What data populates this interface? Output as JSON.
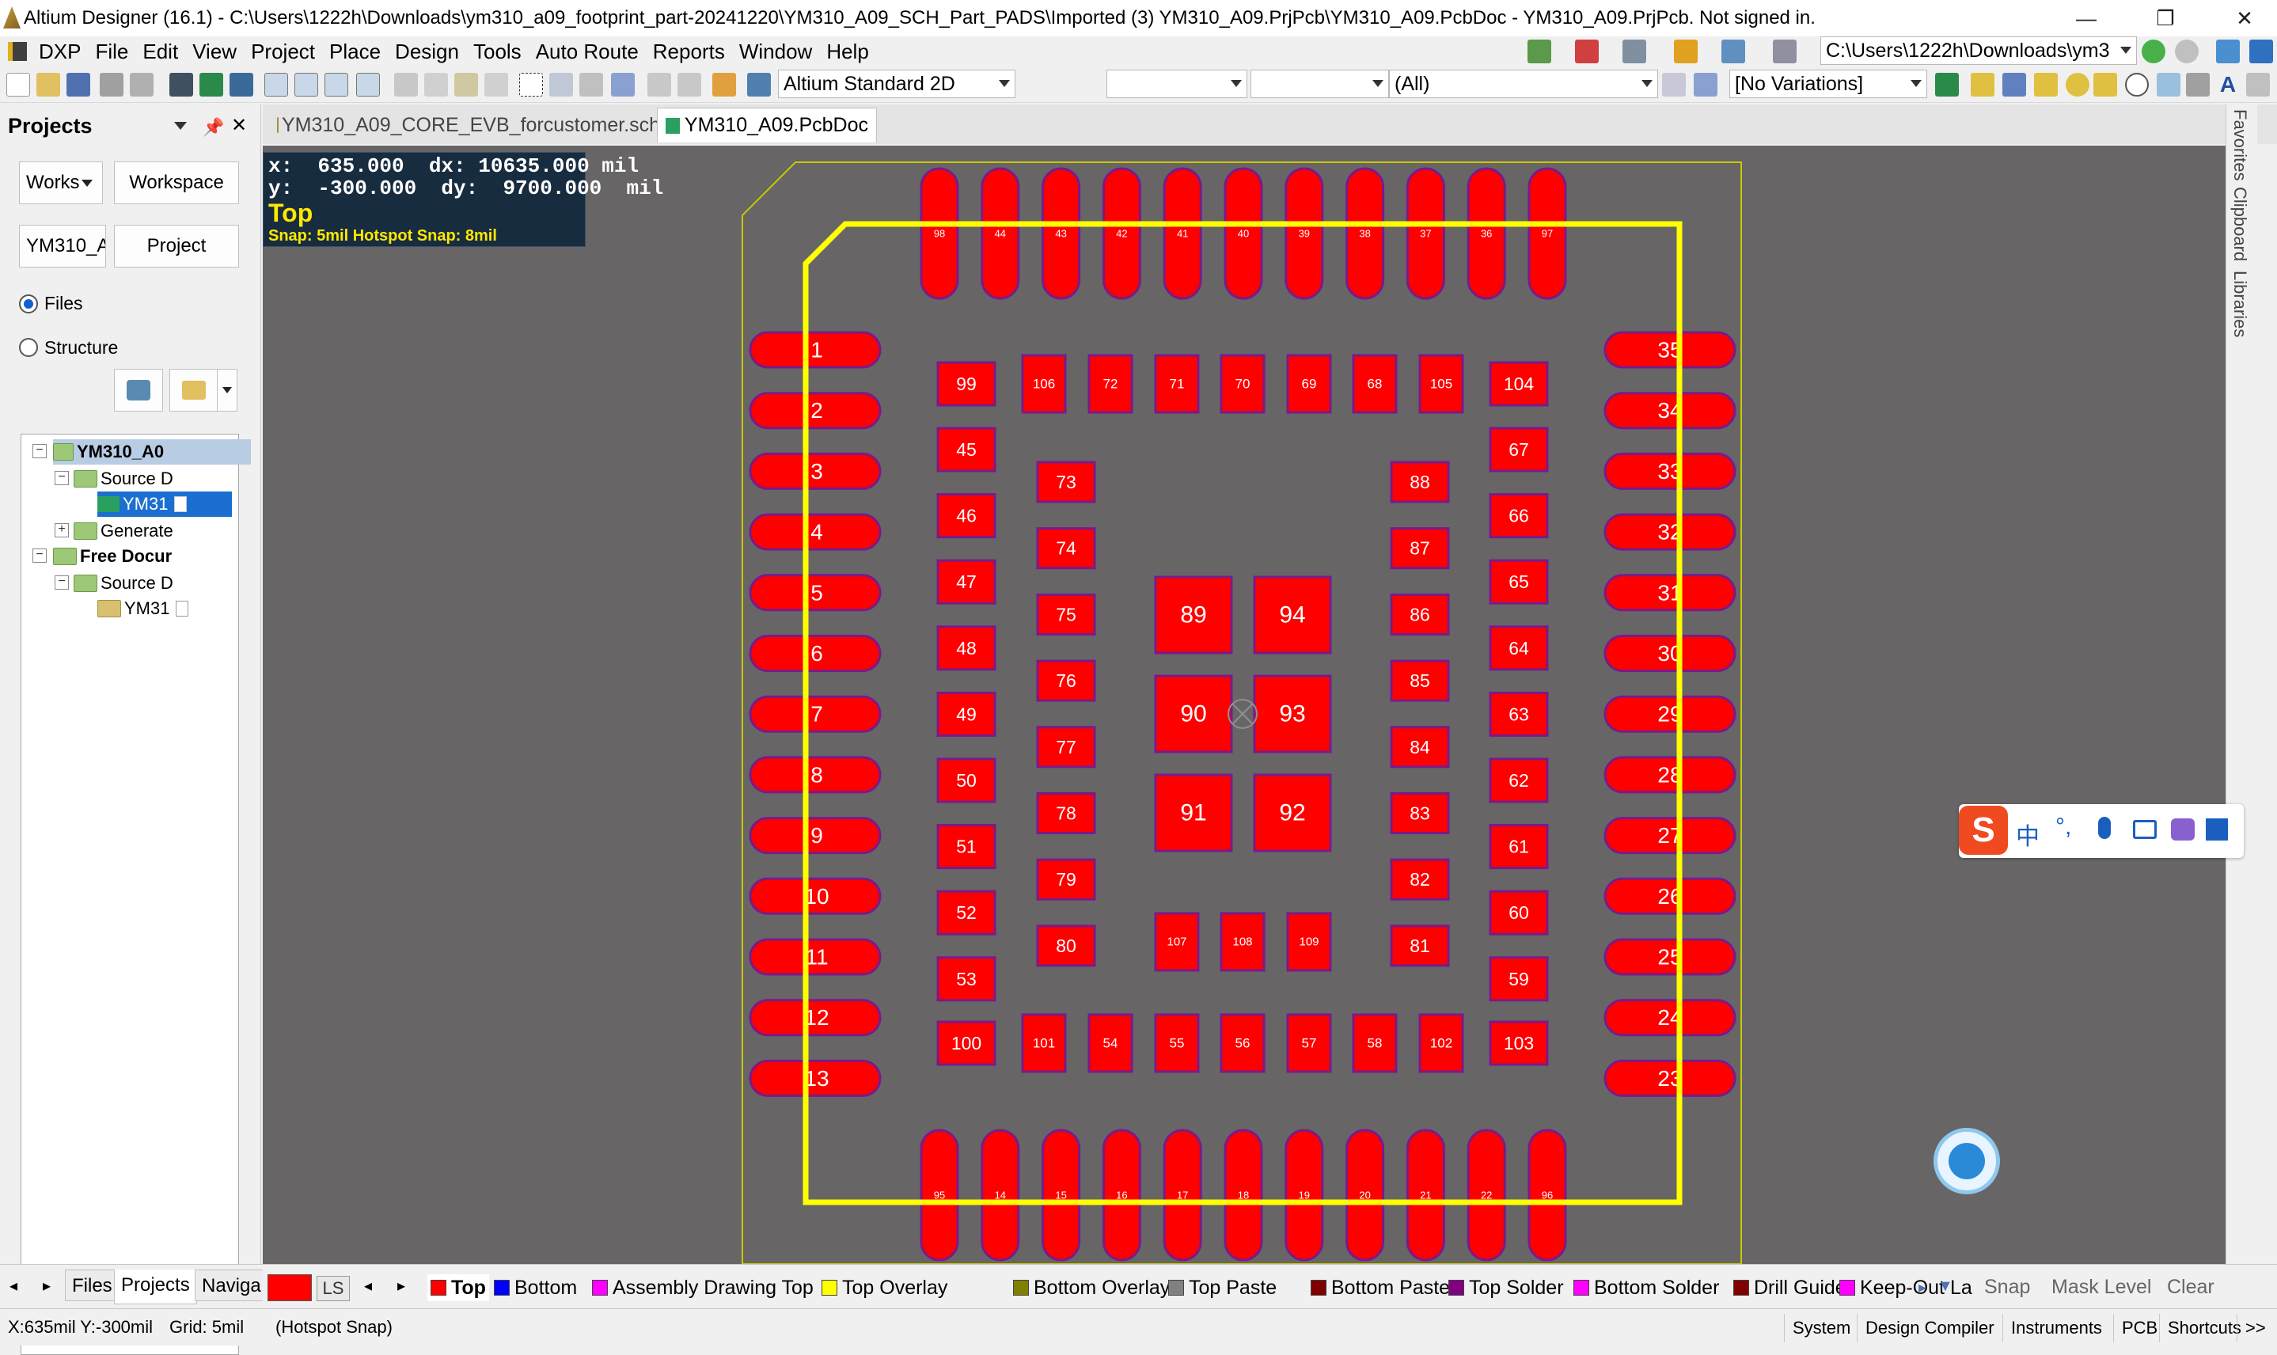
{
  "titlebar": {
    "title": "Altium Designer (16.1) - C:\\Users\\1222h\\Downloads\\ym310_a09_footprint_part-20241220\\YM310_A09_SCH_Part_PADS\\Imported (3) YM310_A09.PrjPcb\\YM310_A09.PcbDoc - YM310_A09.PrjPcb. Not signed in."
  },
  "menu": [
    "DXP",
    "File",
    "Edit",
    "View",
    "Project",
    "Place",
    "Design",
    "Tools",
    "Auto Route",
    "Reports",
    "Window",
    "Help"
  ],
  "path_combo": "C:\\Users\\1222h\\Downloads\\ym3",
  "toolbar": {
    "view_combo": "Altium Standard 2D",
    "filter_combo": "(All)",
    "variations_combo": "[No Variations]"
  },
  "panel": {
    "title": "Projects",
    "workspace_combo": "Works",
    "workspace_button": "Workspace",
    "project_field": "YM310_A(",
    "project_button": "Project",
    "radio_files": "Files",
    "radio_structure": "Structure",
    "tree": [
      {
        "label": "YM310_A0",
        "bold": true,
        "expander": "−"
      },
      {
        "label": "Source D",
        "bold": false,
        "expander": "−"
      },
      {
        "label": "YM31",
        "bold": false,
        "expander": ""
      },
      {
        "label": "Generate",
        "bold": false,
        "expander": "+"
      },
      {
        "label": "Free Docur",
        "bold": true,
        "expander": "−"
      },
      {
        "label": "Source D",
        "bold": false,
        "expander": "−"
      },
      {
        "label": "YM31",
        "bold": false,
        "expander": ""
      }
    ],
    "tabs": [
      "Files",
      "Projects",
      "Naviga"
    ]
  },
  "doc_tabs": [
    "YM310_A09_CORE_EVB_forcustomer.sch",
    "YM310_A09.PcbDoc"
  ],
  "right_strip": [
    "Favorites",
    "Clipboard",
    "Libraries"
  ],
  "coords": {
    "x_line": "x:  635.000  dx: 10635.000 mil",
    "y_line": "y:  -300.000  dy:  9700.000  mil",
    "layer": "Top",
    "snap": "Snap: 5mil Hotspot Snap: 8mil"
  },
  "pads": {
    "left": [
      "1",
      "2",
      "3",
      "4",
      "5",
      "6",
      "7",
      "8",
      "9",
      "10",
      "11",
      "12",
      "13"
    ],
    "right": [
      "35",
      "34",
      "33",
      "32",
      "31",
      "30",
      "29",
      "28",
      "27",
      "26",
      "25",
      "24",
      "23"
    ],
    "top": [
      "98",
      "44",
      "43",
      "42",
      "41",
      "40",
      "39",
      "38",
      "37",
      "36",
      "97"
    ],
    "bottom": [
      "95",
      "14",
      "15",
      "16",
      "17",
      "18",
      "19",
      "20",
      "21",
      "22",
      "96"
    ],
    "inner_top": [
      "99",
      "106",
      "72",
      "71",
      "70",
      "69",
      "68",
      "105",
      "104"
    ],
    "inner_left": [
      "45",
      "46",
      "47",
      "48",
      "49",
      "50",
      "51",
      "52",
      "53"
    ],
    "inner_right": [
      "67",
      "66",
      "65",
      "64",
      "63",
      "62",
      "61",
      "60",
      "59"
    ],
    "inner_bottom": [
      "100",
      "101",
      "54",
      "55",
      "56",
      "57",
      "58",
      "102",
      "103"
    ],
    "ring_left": [
      "73",
      "74",
      "75",
      "76",
      "77",
      "78",
      "79",
      "80"
    ],
    "ring_right": [
      "88",
      "87",
      "86",
      "85",
      "84",
      "83",
      "82",
      "81"
    ],
    "center": [
      "89",
      "94",
      "90",
      "93",
      "91",
      "92"
    ],
    "center_small": [
      "107",
      "108",
      "109"
    ]
  },
  "colors": {
    "board_bg": "#676566",
    "pad_fill": "#ff0000",
    "pad_outline": "#7a1a8a",
    "overlay": "#ffff00",
    "board_outline": "#c8c800"
  },
  "layer_bar": {
    "current_swatch_label": "LS",
    "layers": [
      {
        "name": "Top",
        "color": "#ff0000",
        "bold": true
      },
      {
        "name": "Bottom",
        "color": "#0000ff",
        "bold": false
      },
      {
        "name": "Assembly Drawing Top",
        "color": "#ff00ff",
        "bold": false
      },
      {
        "name": "Top Overlay",
        "color": "#ffff00",
        "bold": false
      },
      {
        "name": "Bottom Overlay",
        "color": "#808000",
        "bold": false
      },
      {
        "name": "Top Paste",
        "color": "#808080",
        "bold": false
      },
      {
        "name": "Bottom Paste",
        "color": "#800000",
        "bold": false
      },
      {
        "name": "Top Solder",
        "color": "#800080",
        "bold": false
      },
      {
        "name": "Bottom Solder",
        "color": "#ff00ff",
        "bold": false
      },
      {
        "name": "Drill Guide",
        "color": "#800000",
        "bold": false
      },
      {
        "name": "Keep-Out La",
        "color": "#ff00ff",
        "bold": false
      }
    ],
    "buttons": [
      "Snap",
      "Mask Level",
      "Clear"
    ]
  },
  "status": {
    "position": "X:635mil Y:-300mil",
    "grid": "Grid: 5mil",
    "snap": "(Hotspot Snap)",
    "tabs": [
      "System",
      "Design Compiler",
      "Instruments",
      "PCB",
      "Shortcuts",
      ">>"
    ]
  },
  "ime": {
    "lang": "中"
  }
}
